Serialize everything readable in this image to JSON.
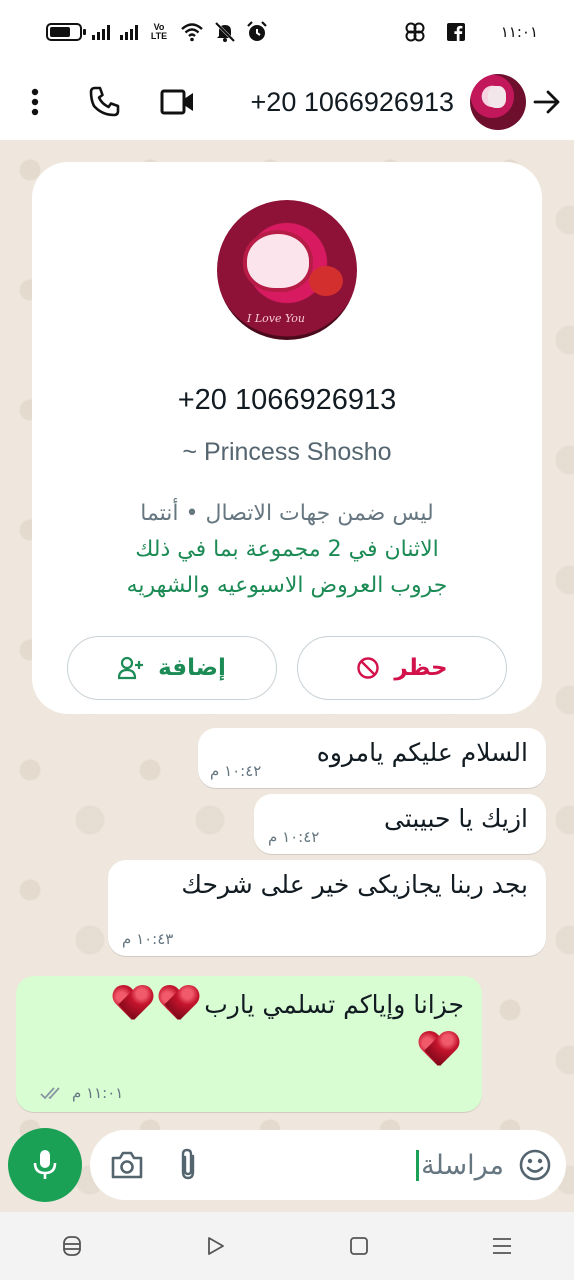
{
  "status_bar": {
    "time": "١١:٠١",
    "volte_label": "Vo LTE",
    "notification_icons": [
      "pinwheel-icon",
      "facebook-icon"
    ],
    "system_icons": [
      "battery-icon",
      "signal-icon",
      "volte-icon",
      "wifi-icon",
      "mute-icon",
      "alarm-icon"
    ]
  },
  "header": {
    "title": "+20 1066926913",
    "icons": [
      "more-icon",
      "voice-call-icon",
      "video-call-icon",
      "back-arrow-icon"
    ]
  },
  "contact_card": {
    "number": "+20 1066926913",
    "name": "~ Princess Shosho",
    "avatar_caption": "I Love You",
    "info_line": "ليس ضمن جهات الاتصال • أنتما",
    "groups_line": "الاثنان في 2 مجموعة بما في ذلك",
    "group_name": "جروب العروض الاسبوعيه والشهريه",
    "add_button": "إضافة",
    "block_button": "حظر"
  },
  "messages": [
    {
      "direction": "in",
      "text": "السلام عليكم يامروه",
      "time": "١٠:٤٢ م"
    },
    {
      "direction": "in",
      "text": "ازيك يا حبيبتى",
      "time": "١٠:٤٢ م"
    },
    {
      "direction": "in",
      "text": "بجد ربنا يجازيكى خير على شرحك",
      "time": "١٠:٤٣ م"
    },
    {
      "direction": "out",
      "text": "جزانا وإياكم تسلمي يارب",
      "time": "١١:٠١ م",
      "status": "read",
      "hearts": 3
    }
  ],
  "composer": {
    "placeholder": "مراسلة",
    "icons": [
      "emoji-icon",
      "attach-icon",
      "camera-icon",
      "mic-icon"
    ]
  },
  "nav_bar": {
    "icons": [
      "menu-icon",
      "home-icon",
      "back-icon",
      "assistant-icon"
    ]
  },
  "colors": {
    "accent": "#1aa155",
    "chat_bg": "#efe7dd",
    "outgoing_bubble": "#d9fdd3",
    "block_red": "#d3124b",
    "link_green": "#1c8b55"
  }
}
